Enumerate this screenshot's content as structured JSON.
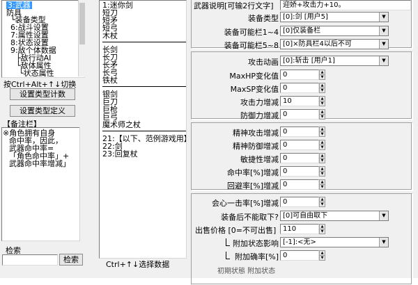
{
  "left": {
    "tree": {
      "items": [
        {
          "text": "3:武器",
          "selected": true
        },
        {
          "text": "防具"
        },
        {
          "text": "└装备类型"
        },
        {
          "text": "6:战斗设置"
        },
        {
          "text": "7:属性设置"
        },
        {
          "text": "8:状态设置"
        },
        {
          "text": "9:敌个体数据"
        },
        {
          "text": "├敌行动AI"
        },
        {
          "text": "└敌体属性"
        },
        {
          "text": "└状态属性"
        }
      ]
    },
    "hint": "按Ctrl+Alt+↑↓切换",
    "set_type_count_button": "设置类型计数",
    "set_type_define_button": "设置类型定义",
    "notes": {
      "title": "【备注栏】",
      "lines": [
        "※角色拥有自身",
        "命中率，因此，",
        "武器命中率=",
        "「角色命中率」+",
        "武器命中率增减」"
      ]
    },
    "search": {
      "label": "检索",
      "value": "",
      "button": "检索"
    }
  },
  "middle": {
    "list": [
      {
        "text": "1:迷你剑"
      },
      {
        "text": "短刀"
      },
      {
        "text": "短矛"
      },
      {
        "text": "短弓"
      },
      {
        "text": "木杖"
      },
      {
        "text": "",
        "separator": true
      },
      {
        "text": "长剑"
      },
      {
        "text": "长刀"
      },
      {
        "text": "长矛"
      },
      {
        "text": "长弓"
      },
      {
        "text": "铁杖"
      },
      {
        "text": "",
        "separator": true
      },
      {
        "text": "银剑"
      },
      {
        "text": "巨刀"
      },
      {
        "text": "巨枪"
      },
      {
        "text": "巨弓"
      },
      {
        "text": "魔术师之杖"
      },
      {
        "text": "",
        "separator": true
      },
      {
        "text": "21:【以下、范例游戏用】"
      },
      {
        "text": "22:剑"
      },
      {
        "text": "23:回复杖"
      }
    ],
    "hint": "Ctrl+↑↓选择数据"
  },
  "right": {
    "desc": {
      "label": "武器说明[可输2行文字]",
      "value": "迎娇+攻击力+10。"
    },
    "equip_type": {
      "label": "装备类型",
      "value": "[0]:剑 [用户5]"
    },
    "slot_1_4": {
      "label": "装备可能栏1~4",
      "value": "[0]仅装备栏"
    },
    "slot_5_8": {
      "label": "装备可能栏5~8",
      "value": "[0]×防具栏4以后不可"
    },
    "attack_anim": {
      "label": "攻击动画",
      "value": "[0]:斩击 [用户1]"
    },
    "maxhp": {
      "label": "MaxHP变化值",
      "value": "0"
    },
    "maxsp": {
      "label": "MaxSP变化值",
      "value": "0"
    },
    "atk": {
      "label": "攻击力增减",
      "value": "10"
    },
    "def": {
      "label": "防御力增减",
      "value": "0"
    },
    "matk": {
      "label": "精神攻击增减",
      "value": "0"
    },
    "mdef": {
      "label": "精神防御增减",
      "value": "0"
    },
    "agi": {
      "label": "敏捷性增减",
      "value": "0"
    },
    "hit": {
      "label": "命中率[%]增减",
      "value": "0"
    },
    "eva": {
      "label": "回避率[%]增减",
      "value": "0"
    },
    "crit": {
      "label": "会心一击率[%]增减",
      "value": "0"
    },
    "unequip": {
      "label": "装备后不能取下?",
      "value": "[0]可自由取下"
    },
    "price": {
      "label": "出售价格 [0=不可出售]",
      "value": "110"
    },
    "state_effect": {
      "label": "附加状态影响",
      "value": "[-1]:<无>"
    },
    "state_rate": {
      "label": "附加确率[%]",
      "value": "0"
    },
    "cut_off": "初期状態   附加状态"
  }
}
